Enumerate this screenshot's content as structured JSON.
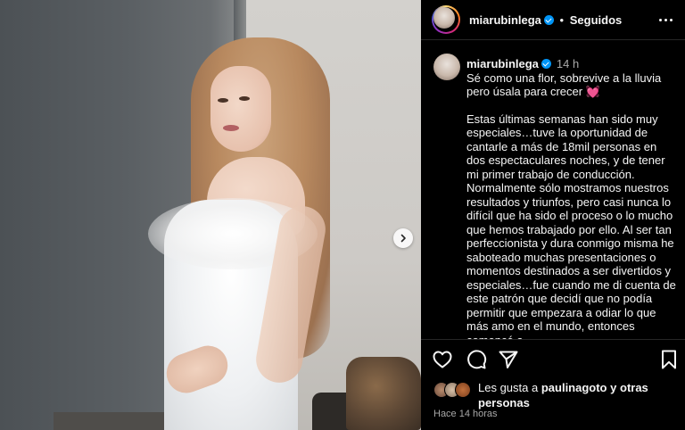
{
  "post": {
    "username": "miarubinlega",
    "dot": "•",
    "follow_status": "Seguidos",
    "more_icon": "more-horizontal-icon"
  },
  "caption": {
    "username": "miarubinlega",
    "time": "14 h",
    "line1": "Sé como una flor, sobrevive a la lluvia pero úsala para crecer",
    "emoji": "💓",
    "paragraph": "Estas últimas semanas han sido muy especiales…tuve la oportunidad de cantarle a más de 18mil personas en dos espectaculares noches, y de tener mi primer trabajo de conducción. Normalmente sólo mostramos nuestros resultados y triunfos, pero casi nunca lo difícil que ha sido el proceso o lo mucho que hemos trabajado por ello. Al ser tan perfeccionista y dura conmigo misma he saboteado muchas presentaciones o momentos destinados a ser divertidos y especiales…fue cuando me di cuenta de este patrón que decidí que no podía permitir que empezara a odiar lo que más amo en el mundo, entonces comencé a"
  },
  "actions": {
    "like_icon": "heart-icon",
    "comment_icon": "comment-icon",
    "share_icon": "send-icon",
    "save_icon": "bookmark-icon"
  },
  "likes": {
    "prefix": "Les gusta a",
    "user": "paulinagoto",
    "suffix": "y",
    "others": "otras personas"
  },
  "timestamp": "Hace 14 horas",
  "colors": {
    "background": "#000000",
    "verified": "#0095f6",
    "muted": "#a8a8a8",
    "text": "#f5f5f5"
  }
}
